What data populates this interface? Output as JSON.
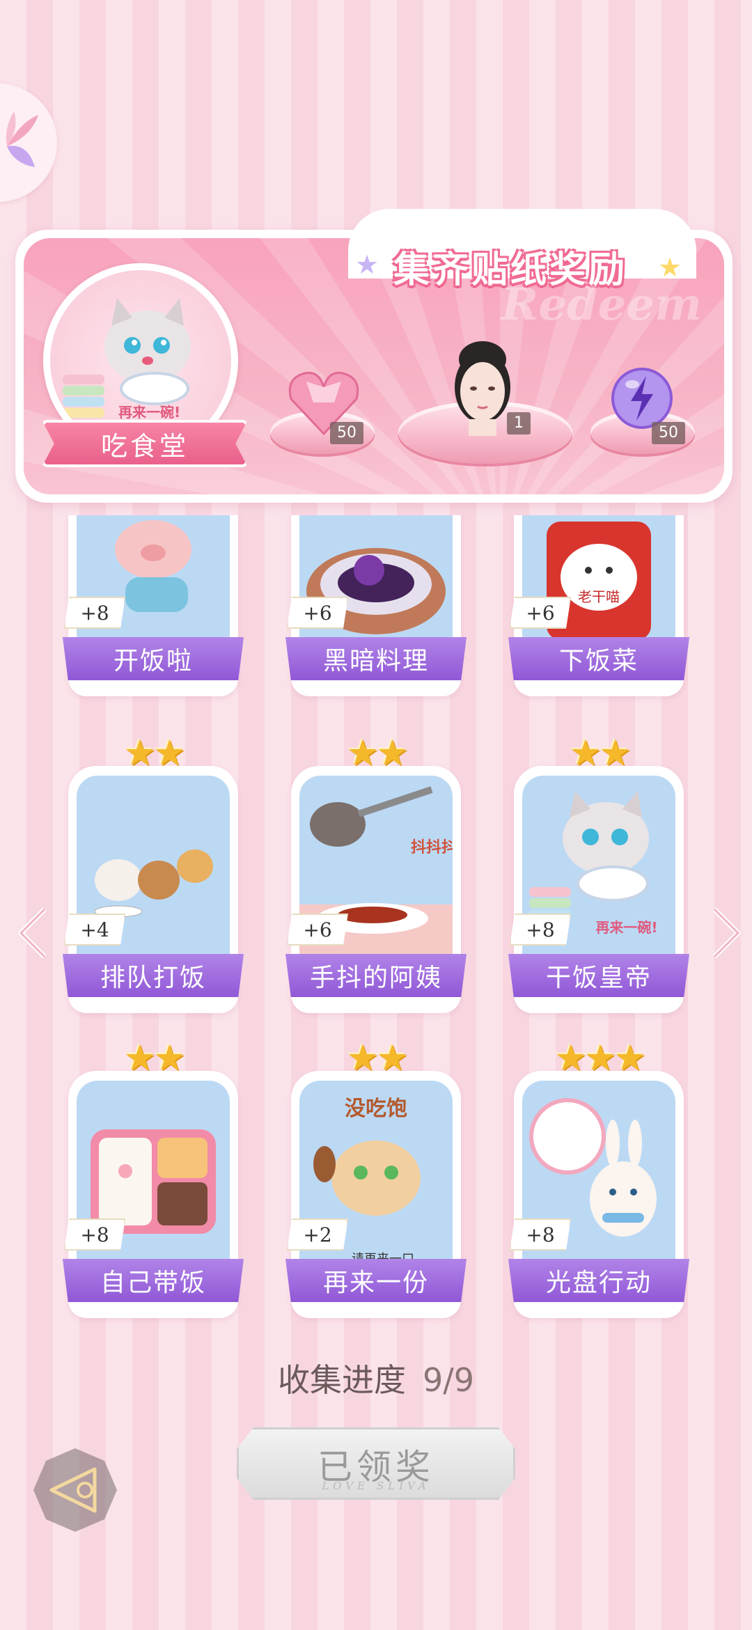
{
  "banner": {
    "title": "集齐贴纸奖励",
    "watermark": "Redeem",
    "collection_name": "吃食堂",
    "logo_tagline": "再来一碗!",
    "rewards": [
      {
        "icon": "pink-heart-gem-icon",
        "count": "50"
      },
      {
        "icon": "character-portrait",
        "count": "1"
      },
      {
        "icon": "purple-lightning-orb-icon",
        "count": "50"
      }
    ]
  },
  "stickers": [
    {
      "name": "开饭啦",
      "points": "+8",
      "stars": "★★",
      "art": "pig-running"
    },
    {
      "name": "黑暗料理",
      "points": "+6",
      "stars": "★★",
      "art": "dark-dish"
    },
    {
      "name": "下饭菜",
      "points": "+6",
      "stars": "★★",
      "art": "chili-sauce-jar",
      "jar_text": "老干喵"
    },
    {
      "name": "排队打饭",
      "points": "+4",
      "stars": "★★",
      "art": "animals-queue"
    },
    {
      "name": "手抖的阿姨",
      "points": "+6",
      "stars": "★★",
      "art": "ladle-pour",
      "art_text": "抖抖抖!"
    },
    {
      "name": "干饭皇帝",
      "points": "+8",
      "stars": "★★",
      "art": "cat-eating",
      "art_text": "再来一碗!"
    },
    {
      "name": "自己带饭",
      "points": "+8",
      "stars": "★★",
      "art": "bento-box"
    },
    {
      "name": "再来一份",
      "points": "+2",
      "stars": "★★",
      "art": "hamster-spoon",
      "art_text_top": "没吃饱",
      "art_text_bottom": "请再来一口"
    },
    {
      "name": "光盘行动",
      "points": "+8",
      "stars": "★★★",
      "art": "bunny-plate"
    }
  ],
  "progress": {
    "label": "收集进度",
    "value": "9/9"
  },
  "claim_button": {
    "label": "已领奖",
    "sub": "LOVE SLIVA"
  },
  "colors": {
    "label_purple": "#9b63dc",
    "pink": "#f7a8be",
    "star": "#f5b82a"
  }
}
